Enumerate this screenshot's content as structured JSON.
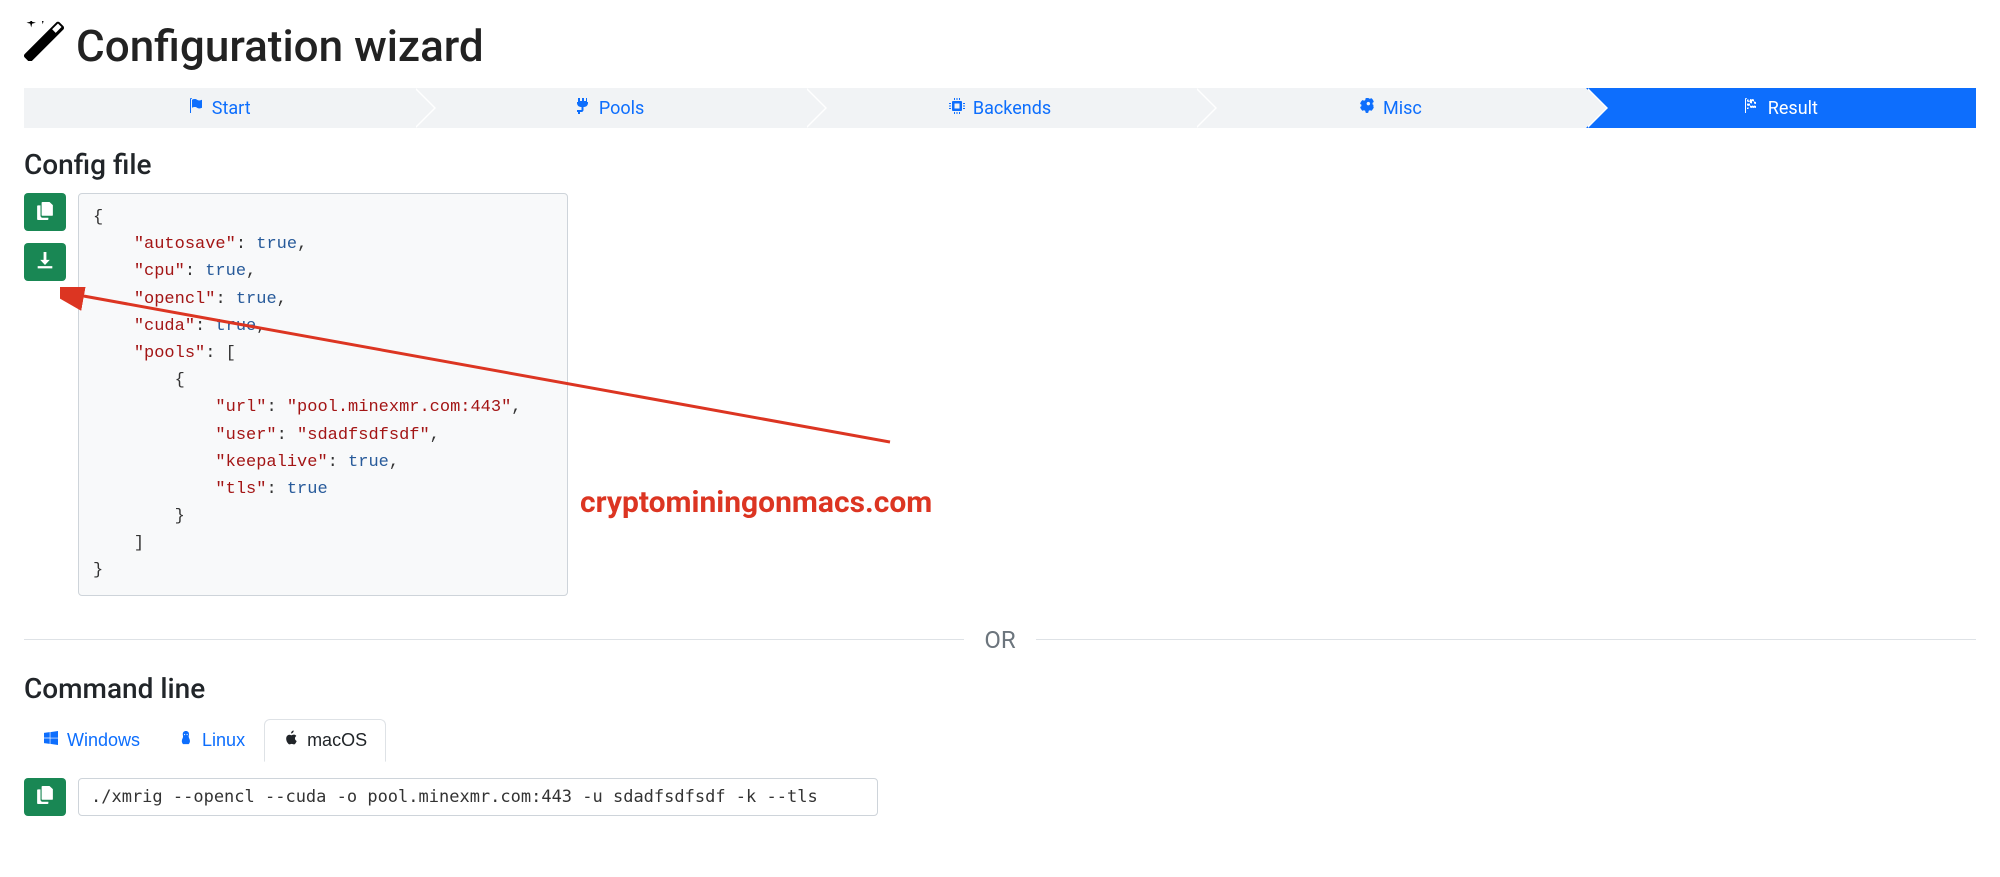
{
  "page_title": "Configuration wizard",
  "steps": {
    "start": "Start",
    "pools": "Pools",
    "backends": "Backends",
    "misc": "Misc",
    "result": "Result"
  },
  "sections": {
    "config_file": "Config file",
    "command_line": "Command line",
    "or_label": "OR"
  },
  "config_json": {
    "autosave": true,
    "cpu": true,
    "opencl": true,
    "cuda": true,
    "pools": [
      {
        "url": "pool.minexmr.com:443",
        "user": "sdadfsdfsdf",
        "keepalive": true,
        "tls": true
      }
    ]
  },
  "os_tabs": {
    "windows": "Windows",
    "linux": "Linux",
    "macos": "macOS"
  },
  "command_line_value": "./xmrig --opencl --cuda -o pool.minexmr.com:443 -u sdadfsdfsdf -k --tls",
  "watermark": "cryptominingonmacs.com"
}
